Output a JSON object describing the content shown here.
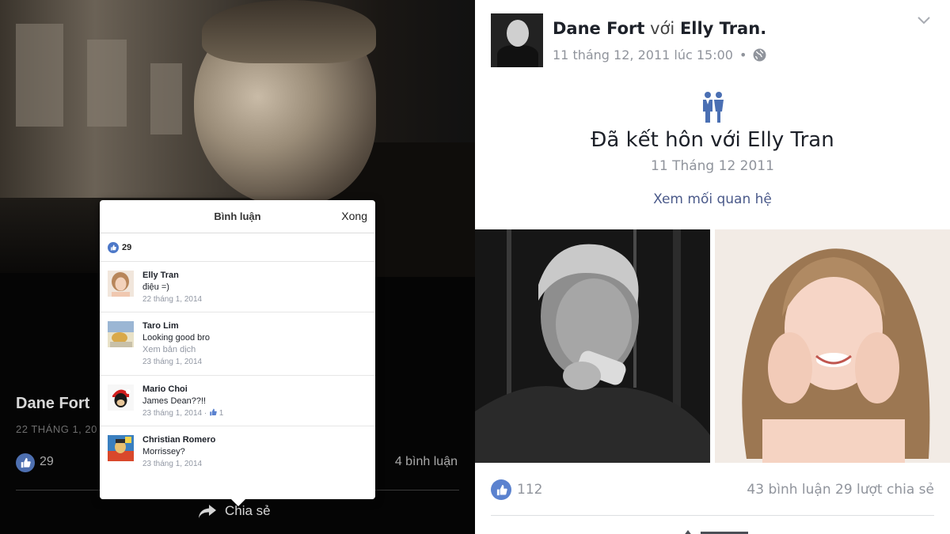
{
  "left": {
    "post_title": "Dane Fort",
    "post_date": "22 THÁNG 1, 20",
    "like_count": "29",
    "comment_count": "4 bình luận",
    "share_label": "Chia sẻ",
    "popover": {
      "title": "Bình luận",
      "done_label": "Xong",
      "like_count": "29",
      "comments": [
        {
          "name": "Elly Tran",
          "text": "điệu =)",
          "translate": "",
          "date": "22 tháng 1, 2014",
          "likes": ""
        },
        {
          "name": "Taro Lim",
          "text": "Looking good bro",
          "translate": "Xem bản dịch",
          "date": "23 tháng 1, 2014",
          "likes": ""
        },
        {
          "name": "Mario Choi",
          "text": "James Dean??!!",
          "translate": "",
          "date": "23 tháng 1, 2014 · ",
          "likes": "1"
        },
        {
          "name": "Christian Romero",
          "text": "Morrissey?",
          "translate": "",
          "date": "23 tháng 1, 2014",
          "likes": ""
        }
      ]
    }
  },
  "right": {
    "author": "Dane Fort",
    "with_word": "với",
    "partner": "Elly Tran",
    "timestamp": "11 tháng 12, 2011 lúc 15:00",
    "event_title": "Đã kết hôn với Elly Tran",
    "event_date": "11 Tháng 12 2011",
    "view_relationship": "Xem mối quan hệ",
    "like_count": "112",
    "stats": "43 bình luận 29 lượt chia sẻ"
  },
  "colors": {
    "like_blue": "#5b82cf",
    "link_blue": "#4b5a8a",
    "meta_gray": "#90949c"
  },
  "icons": [
    "like-icon",
    "share-arrow-icon",
    "globe-icon",
    "chevron-down-icon",
    "married-couple-icon",
    "thumb-up-icon"
  ]
}
